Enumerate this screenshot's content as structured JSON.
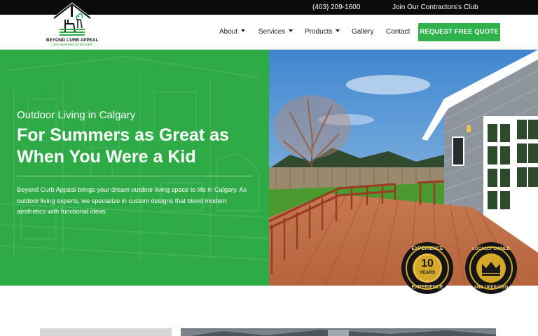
{
  "topbar": {
    "phone": "(403) 209-1600",
    "club_link": "Join Our Contractors's Club"
  },
  "logo": {
    "name": "BEYOND CURB APPEAL",
    "tagline": "LIFE HAPPENS OUTDOORS"
  },
  "nav": {
    "items": [
      {
        "label": "About",
        "has_dropdown": true
      },
      {
        "label": "Services",
        "has_dropdown": true
      },
      {
        "label": "Products",
        "has_dropdown": true
      },
      {
        "label": "Gallery",
        "has_dropdown": false
      },
      {
        "label": "Contact",
        "has_dropdown": false
      }
    ],
    "cta_label": "REQUEST FREE QUOTE"
  },
  "hero": {
    "subtitle": "Outdoor Living in Calgary",
    "title": "For Summers as Great as When You Were a Kid",
    "body": "Beyond Curb Appeal brings your dream outdoor living space to life in Calgary. As outdoor living experts, we specialize in custom designs that blend modern aesthetics with functional ideas."
  },
  "badges": {
    "experience": {
      "top": "EXPERIENCE",
      "number": "10",
      "unit": "YEARS",
      "bottom": "EXPERIENCE"
    },
    "local": {
      "top": "LOCALLY OWNED",
      "bottom": "AND OPERATED"
    }
  },
  "colors": {
    "brand_green": "#2fb24b",
    "hero_green": "#2eaa47",
    "topbar": "#0b0b0b",
    "badge_gold": "#d6a82a"
  },
  "icons": {
    "logo": "house-with-chair-logo-icon",
    "nav_dropdown": "caret-down-icon",
    "badge_crown": "crown-icon"
  }
}
